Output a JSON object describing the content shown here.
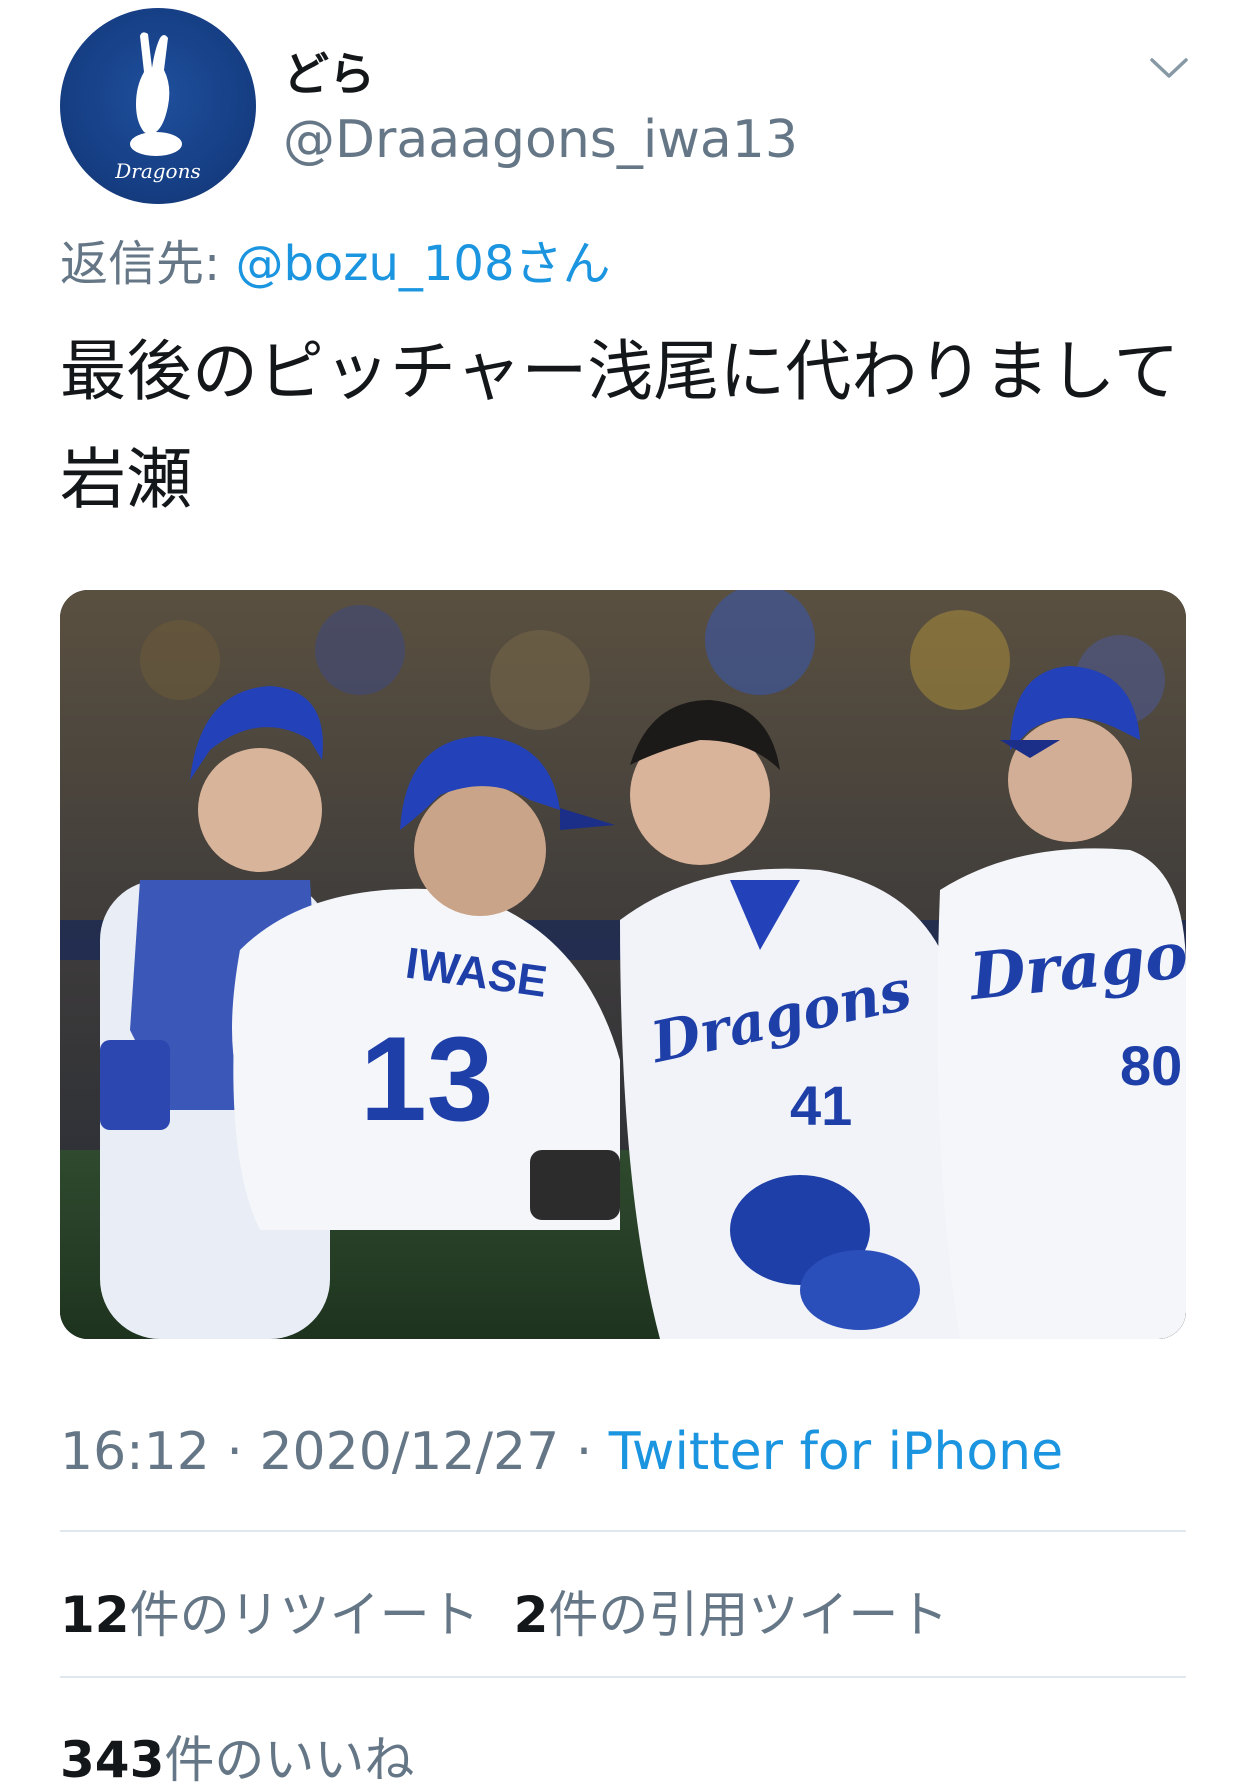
{
  "user": {
    "display_name": "どら",
    "handle": "@Draaagons_iwa13",
    "avatar_logo_text": "Dragons"
  },
  "reply": {
    "label": "返信先: ",
    "mention": "@bozu_108さん"
  },
  "tweet": {
    "text": "最後のピッチャー浅尾に代わりまして岩瀬"
  },
  "photo": {
    "jersey_name": "IWASE",
    "jersey_number_back": "13",
    "jersey_number_41": "41",
    "jersey_number_80": "80",
    "team_text": "Dragons"
  },
  "meta": {
    "time": "16:12",
    "separator": " · ",
    "date": "2020/12/27",
    "source": "Twitter for iPhone"
  },
  "stats": {
    "retweets_count": "12",
    "retweets_label": "件のリツイート",
    "quotes_count": "2",
    "quotes_label": "件の引用ツイート",
    "likes_count": "343",
    "likes_label": "件のいいね"
  },
  "colors": {
    "link": "#1b95e0",
    "secondary_text": "#657786",
    "primary_text": "#14171a",
    "divider": "#e1e8ed",
    "dragons_blue": "#1f3fa8"
  },
  "icons": {
    "caret": "chevron-down-icon"
  }
}
